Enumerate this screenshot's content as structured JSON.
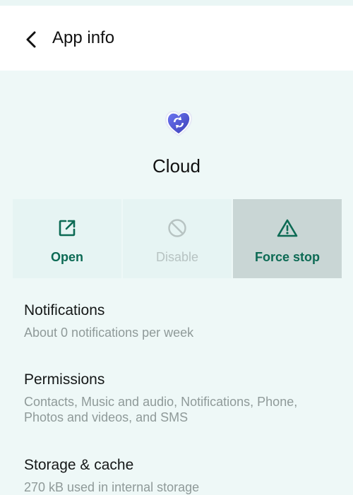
{
  "header": {
    "title": "App info",
    "back_icon": "arrow-back-icon"
  },
  "app": {
    "name": "Cloud",
    "icon": "cloud-sync-app-icon",
    "icon_color": "#4a51d6"
  },
  "actions": [
    {
      "label": "Open",
      "icon": "open-external-icon",
      "enabled": true
    },
    {
      "label": "Disable",
      "icon": "disable-circle-icon",
      "enabled": false
    },
    {
      "label": "Force stop",
      "icon": "warning-triangle-icon",
      "enabled": true,
      "pressed": true
    }
  ],
  "sections": {
    "notifications": {
      "title": "Notifications",
      "summary": "About 0 notifications per week"
    },
    "permissions": {
      "title": "Permissions",
      "summary": "Contacts, Music and audio, Notifications, Phone, Photos and videos, and SMS"
    },
    "storage": {
      "title": "Storage & cache",
      "summary": "270 kB used in internal storage"
    }
  },
  "colors": {
    "accent": "#0c6a54",
    "background": "#eef8f7",
    "disabled": "#b7c3c2"
  }
}
